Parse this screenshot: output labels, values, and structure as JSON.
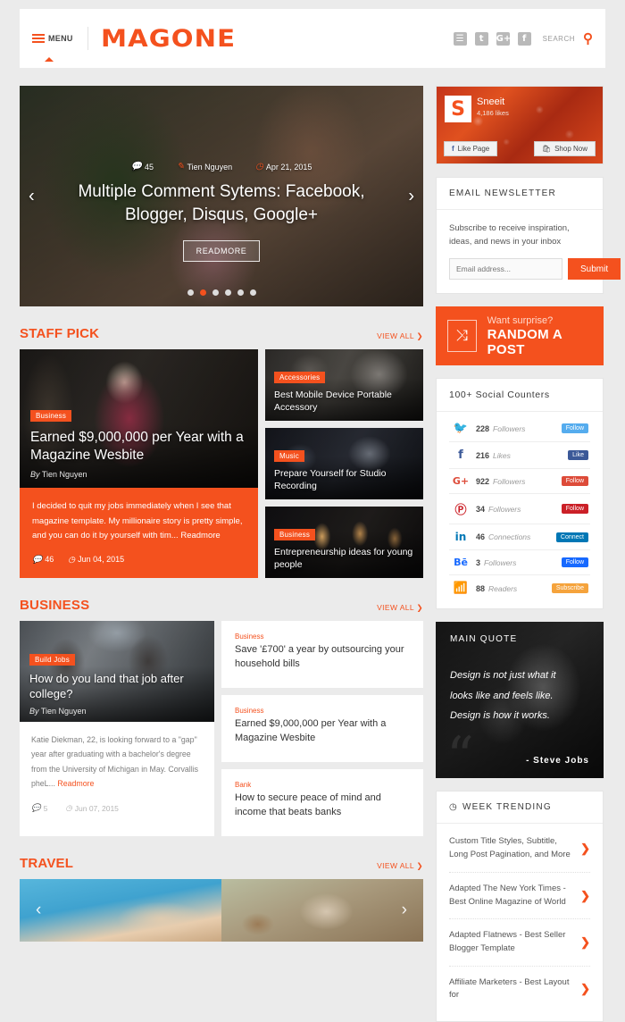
{
  "header": {
    "menu_label": "MENU",
    "logo": "MAGONE",
    "search_label": "SEARCH",
    "social": [
      {
        "name": "instagram-icon",
        "glyph": "☰"
      },
      {
        "name": "twitter-icon",
        "glyph": "t"
      },
      {
        "name": "googleplus-icon",
        "glyph": "G+"
      },
      {
        "name": "facebook-icon",
        "glyph": "f"
      }
    ]
  },
  "hero": {
    "comments": "45",
    "author": "Tien Nguyen",
    "date": "Apr 21, 2015",
    "title": "Multiple Comment Sytems: Facebook, Blogger, Disqus, Google+",
    "readmore": "READMORE",
    "dot_count": 6,
    "active_dot": 2,
    "prev": "‹",
    "next": "›"
  },
  "staff_pick": {
    "section_title": "STAFF PICK",
    "view_all": "VIEW ALL ❯",
    "featured": {
      "category": "Business",
      "title": "Earned $9,000,000 per Year with a Magazine Wesbite",
      "by_prefix": "By",
      "author": "Tien Nguyen",
      "excerpt": "I decided to quit my jobs immediately when I see that magazine template. My millionaire story is pretty simple, and you can do it by yourself with tim...",
      "readmore": "Readmore",
      "comments": "46",
      "date": "Jun 04, 2015"
    },
    "cards": [
      {
        "category": "Accessories",
        "title": "Best Mobile Device Portable Accessory"
      },
      {
        "category": "Music",
        "title": "Prepare Yourself for Studio Recording"
      },
      {
        "category": "Business",
        "title": "Entrepreneurship ideas for young people"
      }
    ]
  },
  "business": {
    "section_title": "BUSINESS",
    "view_all": "VIEW ALL ❯",
    "featured": {
      "category": "Build Jobs",
      "title": "How do you land that job after college?",
      "by_prefix": "By",
      "author": "Tien Nguyen",
      "excerpt": "Katie Diekman, 22, is looking forward to a \"gap\" year after graduating with a bachelor's degree from the University of Michigan in May. Corvallis pheL...",
      "readmore": "Readmore",
      "comments": "5",
      "date": "Jun 07, 2015"
    },
    "cards": [
      {
        "category": "Business",
        "title": "Save '£700' a year by outsourcing your household bills"
      },
      {
        "category": "Business",
        "title": "Earned $9,000,000 per Year with a Magazine Wesbite"
      },
      {
        "category": "Bank",
        "title": "How to secure peace of mind and income that beats banks"
      }
    ]
  },
  "travel": {
    "section_title": "TRAVEL",
    "view_all": "VIEW ALL ❯",
    "prev": "‹",
    "next": "›"
  },
  "sidebar": {
    "facebook": {
      "logo_letter": "S",
      "page_name": "Sneeit",
      "likes": "4,186 likes",
      "like_button": "Like Page",
      "shop_button": "Shop Now"
    },
    "newsletter": {
      "title": "EMAIL NEWSLETTER",
      "text": "Subscribe to receive inspiration, ideas, and news in your inbox",
      "placeholder": "Email address...",
      "submit": "Submit"
    },
    "random": {
      "small": "Want surprise?",
      "big": "RANDOM A POST",
      "icon": "⤨"
    },
    "social_counters": {
      "title": "100+ Social Counters",
      "rows": [
        {
          "icon_name": "twitter-icon",
          "glyph": "🐦",
          "color": "#55acee",
          "count": "228",
          "label": "Followers",
          "action": "Follow",
          "action_color": "#55acee"
        },
        {
          "icon_name": "facebook-icon",
          "glyph": "f",
          "color": "#3b5998",
          "count": "216",
          "label": "Likes",
          "action": "Like",
          "action_color": "#3b5998"
        },
        {
          "icon_name": "googleplus-icon",
          "glyph": "G+",
          "color": "#dd4b39",
          "count": "922",
          "label": "Followers",
          "action": "Follow",
          "action_color": "#dd4b39"
        },
        {
          "icon_name": "pinterest-icon",
          "glyph": "Ⓟ",
          "color": "#cb2027",
          "count": "34",
          "label": "Followers",
          "action": "Follow",
          "action_color": "#cb2027"
        },
        {
          "icon_name": "linkedin-icon",
          "glyph": "in",
          "color": "#0077b5",
          "count": "46",
          "label": "Connections",
          "action": "Connect",
          "action_color": "#0077b5"
        },
        {
          "icon_name": "behance-icon",
          "glyph": "Bē",
          "color": "#1769ff",
          "count": "3",
          "label": "Followers",
          "action": "Follow",
          "action_color": "#1769ff"
        },
        {
          "icon_name": "rss-icon",
          "glyph": "◔",
          "color": "#f5a33c",
          "count": "88",
          "label": "Readers",
          "action": "Subscribe",
          "action_color": "#f5a33c"
        }
      ]
    },
    "quote": {
      "title": "MAIN QUOTE",
      "lines": [
        "Design is not just what it",
        "looks like and feels like.",
        "Design is how it works."
      ],
      "author": "- Steve Jobs"
    },
    "trending": {
      "title": "WEEK TRENDING",
      "clock_icon": "◷",
      "items": [
        "Custom Title Styles, Subtitle, Long Post Pagination, and More",
        "Adapted The New York Times - Best Online Magazine of World",
        "Adapted Flatnews - Best Seller Blogger Template",
        "Affiliate Marketers - Best Layout for"
      ],
      "arrow": "❯"
    }
  },
  "icons": {
    "comment": "💬",
    "pencil": "✎",
    "clock": "◷"
  },
  "colors": {
    "accent": "#f4511e",
    "page_bg": "#ebebeb"
  }
}
